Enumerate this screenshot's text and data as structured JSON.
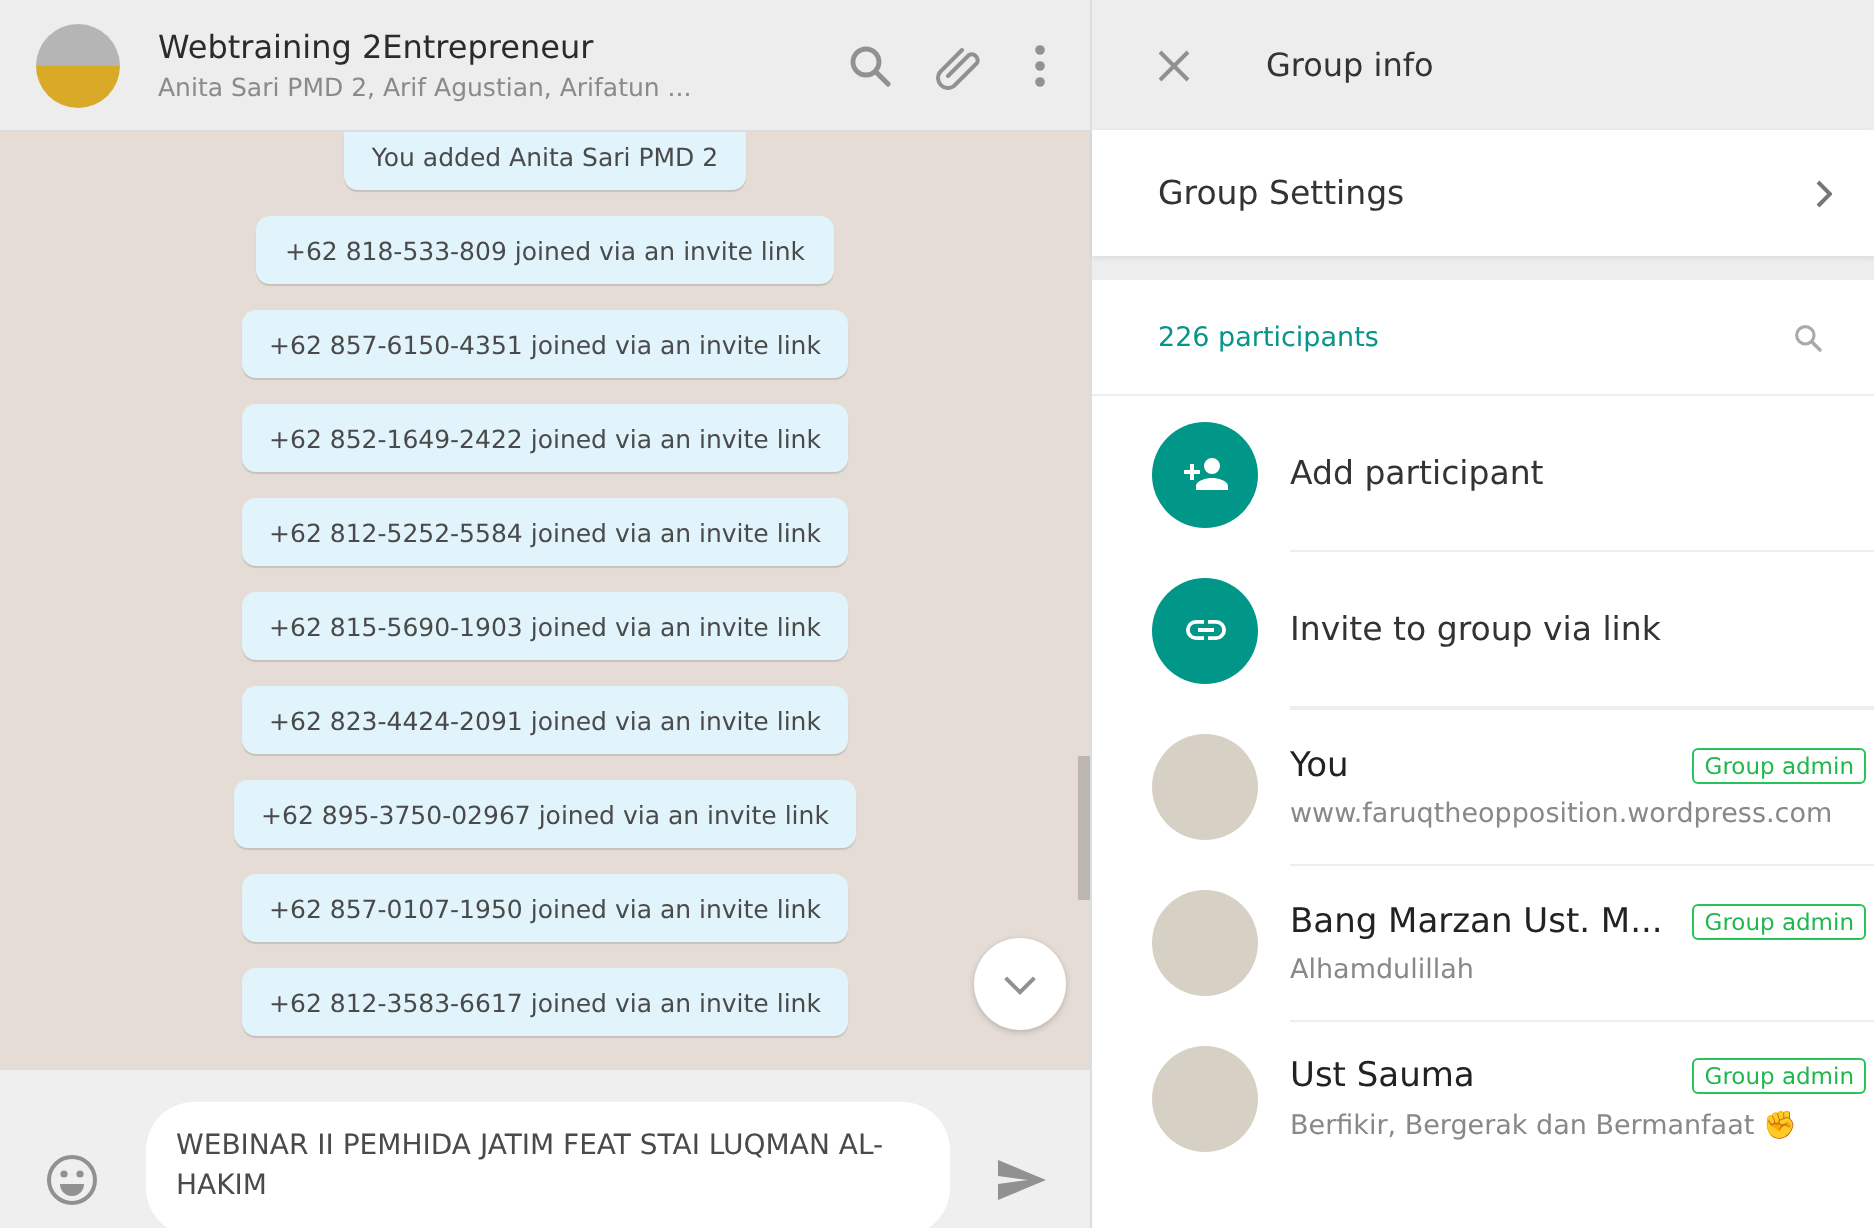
{
  "chat": {
    "title": "Webtraining 2Entrepreneur",
    "subtitle": "Anita Sari PMD 2, Arif Agustian, Arifatun ...",
    "messages": [
      "You added Anita Sari PMD 2",
      "+62 818-533-809 joined via an invite link",
      "+62 857-6150-4351 joined via an invite link",
      "+62 852-1649-2422 joined via an invite link",
      "+62 812-5252-5584 joined via an invite link",
      "+62 815-5690-1903 joined via an invite link",
      "+62 823-4424-2091 joined via an invite link",
      "+62 895-3750-02967 joined via an invite link",
      "+62 857-0107-1950 joined via an invite link",
      "+62 812-3583-6617 joined via an invite link"
    ],
    "composer": {
      "value": "WEBINAR II PEMHIDA JATIM FEAT STAI LUQMAN AL-HAKIM"
    }
  },
  "group_info": {
    "title": "Group info",
    "settings_label": "Group Settings",
    "participants_count": "226 participants",
    "actions": [
      {
        "kind": "add",
        "label": "Add participant"
      },
      {
        "kind": "link",
        "label": "Invite to group via link"
      }
    ],
    "members": [
      {
        "name": "You",
        "status": "www.faruqtheopposition.wordpress.com",
        "badge": "Group admin"
      },
      {
        "name": "Bang Marzan Ust. M...",
        "status": "Alhamdulillah",
        "badge": "Group admin"
      },
      {
        "name": "Ust Sauma",
        "status": "Berfikir, Bergerak dan Bermanfaat ✊",
        "badge": "Group admin"
      }
    ]
  }
}
